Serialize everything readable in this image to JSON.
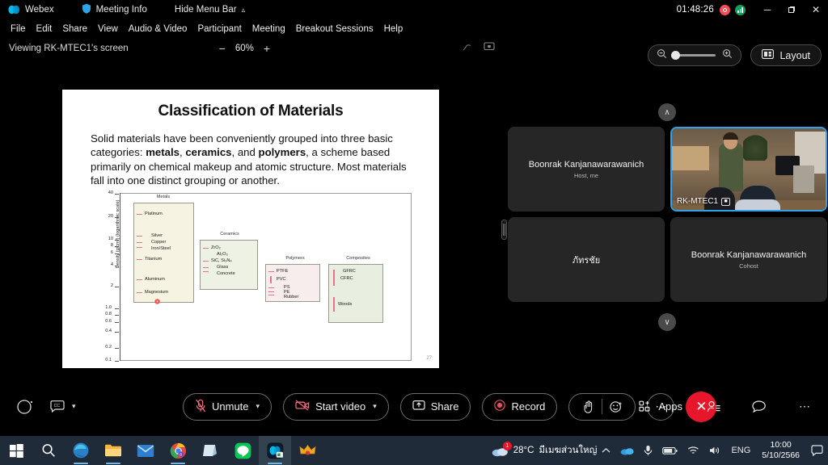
{
  "titlebar": {
    "app_name": "Webex",
    "meeting_info": "Meeting Info",
    "hide_menu_bar": "Hide Menu Bar",
    "timer": "01:48:26",
    "minimize": "─",
    "maximize": "❐",
    "close": "✕"
  },
  "menubar": {
    "items": [
      {
        "label": "File"
      },
      {
        "label": "Edit"
      },
      {
        "label": "Share"
      },
      {
        "label": "View"
      },
      {
        "label": "Audio & Video"
      },
      {
        "label": "Participant"
      },
      {
        "label": "Meeting"
      },
      {
        "label": "Breakout Sessions"
      },
      {
        "label": "Help"
      }
    ]
  },
  "viewbar": {
    "viewing_label": "Viewing RK-MTEC1's screen",
    "zoom_out": "−",
    "zoom_value": "60%",
    "zoom_in": "+"
  },
  "controls": {
    "layout_label": "Layout"
  },
  "slide": {
    "title": "Classification of Materials",
    "body_part1": "Solid materials have been conveniently grouped into three basic categories: ",
    "bold1": "metals",
    "comma1": ", ",
    "bold2": "ceramics",
    "and": ", and ",
    "bold3": "polymers",
    "body_part2": ", a scheme based primarily on chemical makeup and atomic structure. Most materials fall into one distinct grouping or another.",
    "slide_number": "27"
  },
  "chart_data": {
    "type": "bar",
    "title": "Classification of Materials",
    "ylabel": "Density (g/cm3) (logarithmic scale)",
    "ylabel_display": "Density (g/cm³) (logarithmic scale)",
    "yscale": "log",
    "ylim": [
      0.1,
      50
    ],
    "yticks": [
      "40",
      "20",
      "10",
      "8",
      "6",
      "4",
      "2",
      "1.0",
      "0.8",
      "0.6",
      "0.4",
      "0.2",
      "0.1"
    ],
    "grid": false,
    "legend": "none",
    "categories": [
      "Metals",
      "Ceramics",
      "Polymers",
      "Composites"
    ],
    "series": [
      {
        "name": "Metals",
        "items": [
          {
            "label": "Platinum",
            "value": 21.4
          },
          {
            "label": "Silver",
            "value": 10.5
          },
          {
            "label": "Copper",
            "value": 8.9
          },
          {
            "label": "Iron/Steel",
            "value": 7.8
          },
          {
            "label": "Titanium",
            "value": 4.5
          },
          {
            "label": "Aluminum",
            "value": 2.7
          },
          {
            "label": "Magnesium",
            "value": 1.7
          }
        ]
      },
      {
        "name": "Ceramics",
        "items": [
          {
            "label": "ZrO₂",
            "value": 5.6
          },
          {
            "label": "Al₂O₃",
            "value": 4.0
          },
          {
            "label": "SiC, Si₃N₄",
            "value": 3.2
          },
          {
            "label": "Glass",
            "value": 2.5
          },
          {
            "label": "Concrete",
            "value": 2.4
          }
        ]
      },
      {
        "name": "Polymers",
        "items": [
          {
            "label": "PTFE",
            "value": 2.2
          },
          {
            "label": "PVC",
            "value": 1.4
          },
          {
            "label": "PS",
            "value": 1.05
          },
          {
            "label": "PE",
            "value": 0.95
          },
          {
            "label": "Rubber",
            "value": 0.92
          }
        ]
      },
      {
        "name": "Composites",
        "items": [
          {
            "label": "GFRC",
            "value": 2.0
          },
          {
            "label": "CFRC",
            "value": 1.6
          },
          {
            "label": "Woods",
            "value": 0.6
          }
        ]
      }
    ]
  },
  "video_panel": {
    "scroll_up": "∧",
    "scroll_down": "∨",
    "tiles": [
      {
        "name": "Boonrak Kanjanawarawanich",
        "role": "Host, me",
        "has_video": false,
        "active": false
      },
      {
        "name": "RK-MTEC1",
        "role": "",
        "has_video": true,
        "active": true
      },
      {
        "name": "ภัทรชัย",
        "role": "",
        "has_video": false,
        "active": false
      },
      {
        "name": "Boonrak Kanjanawarawanich",
        "role": "Cohost",
        "has_video": false,
        "active": false
      }
    ]
  },
  "toolbar": {
    "unmute_label": "Unmute",
    "start_video_label": "Start video",
    "share_label": "Share",
    "record_label": "Record",
    "more_label": "⋯",
    "leave_label": "✕",
    "apps_label": "Apps",
    "options_label": "⋯"
  },
  "taskbar": {
    "weather_temp": "28°C",
    "weather_text": "มีเมฆส่วนใหญ่",
    "notification_count": "1",
    "language": "ENG",
    "time": "10:00",
    "date": "5/10/2566"
  }
}
